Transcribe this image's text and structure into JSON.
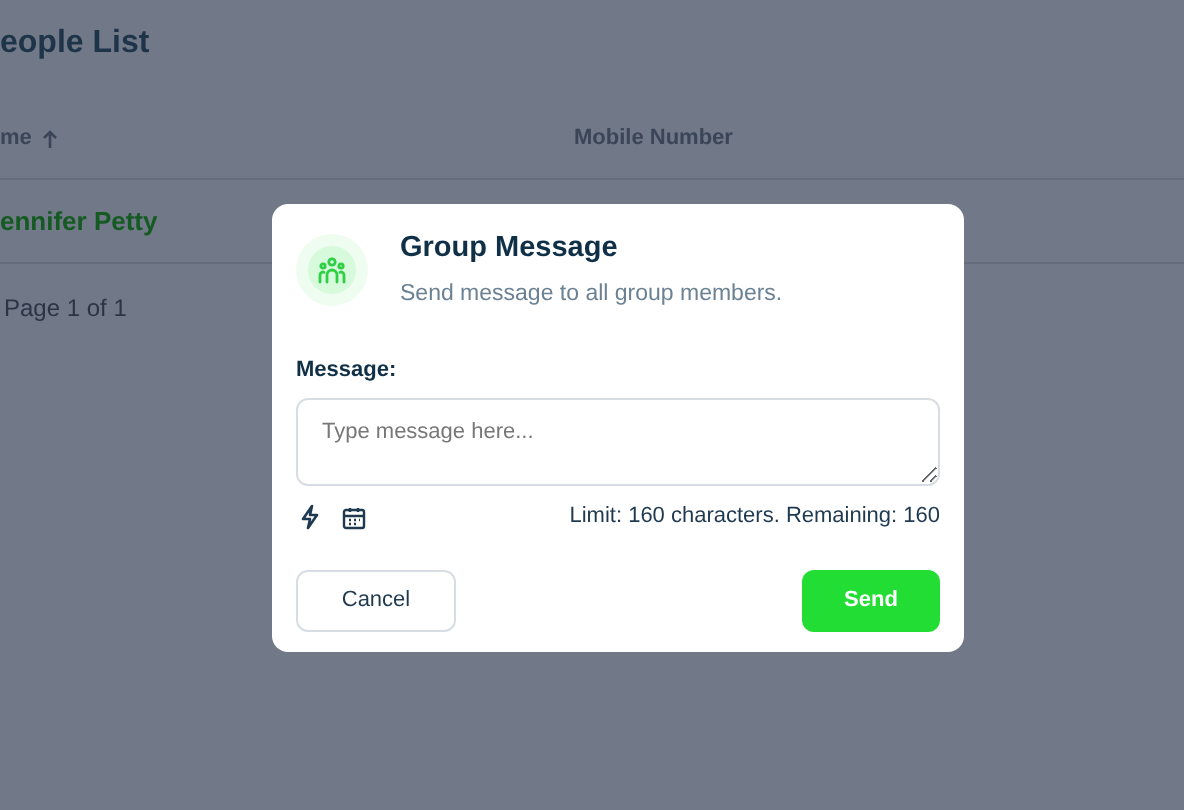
{
  "page": {
    "title": "eople List",
    "columns": [
      {
        "label": "me",
        "sorted": true
      },
      {
        "label": "Mobile Number",
        "sorted": false
      }
    ],
    "rows": [
      {
        "name": "ennifer Petty"
      }
    ],
    "pagination": "Page 1 of 1"
  },
  "dialog": {
    "title": "Group Message",
    "subtitle": "Send message to all group members.",
    "field_label": "Message:",
    "placeholder": "Type message here...",
    "limit_text": "Limit: 160 characters. Remaining: 160",
    "buttons": [
      {
        "label": "Cancel",
        "kind": "secondary"
      },
      {
        "label": "Send",
        "kind": "primary"
      }
    ]
  }
}
